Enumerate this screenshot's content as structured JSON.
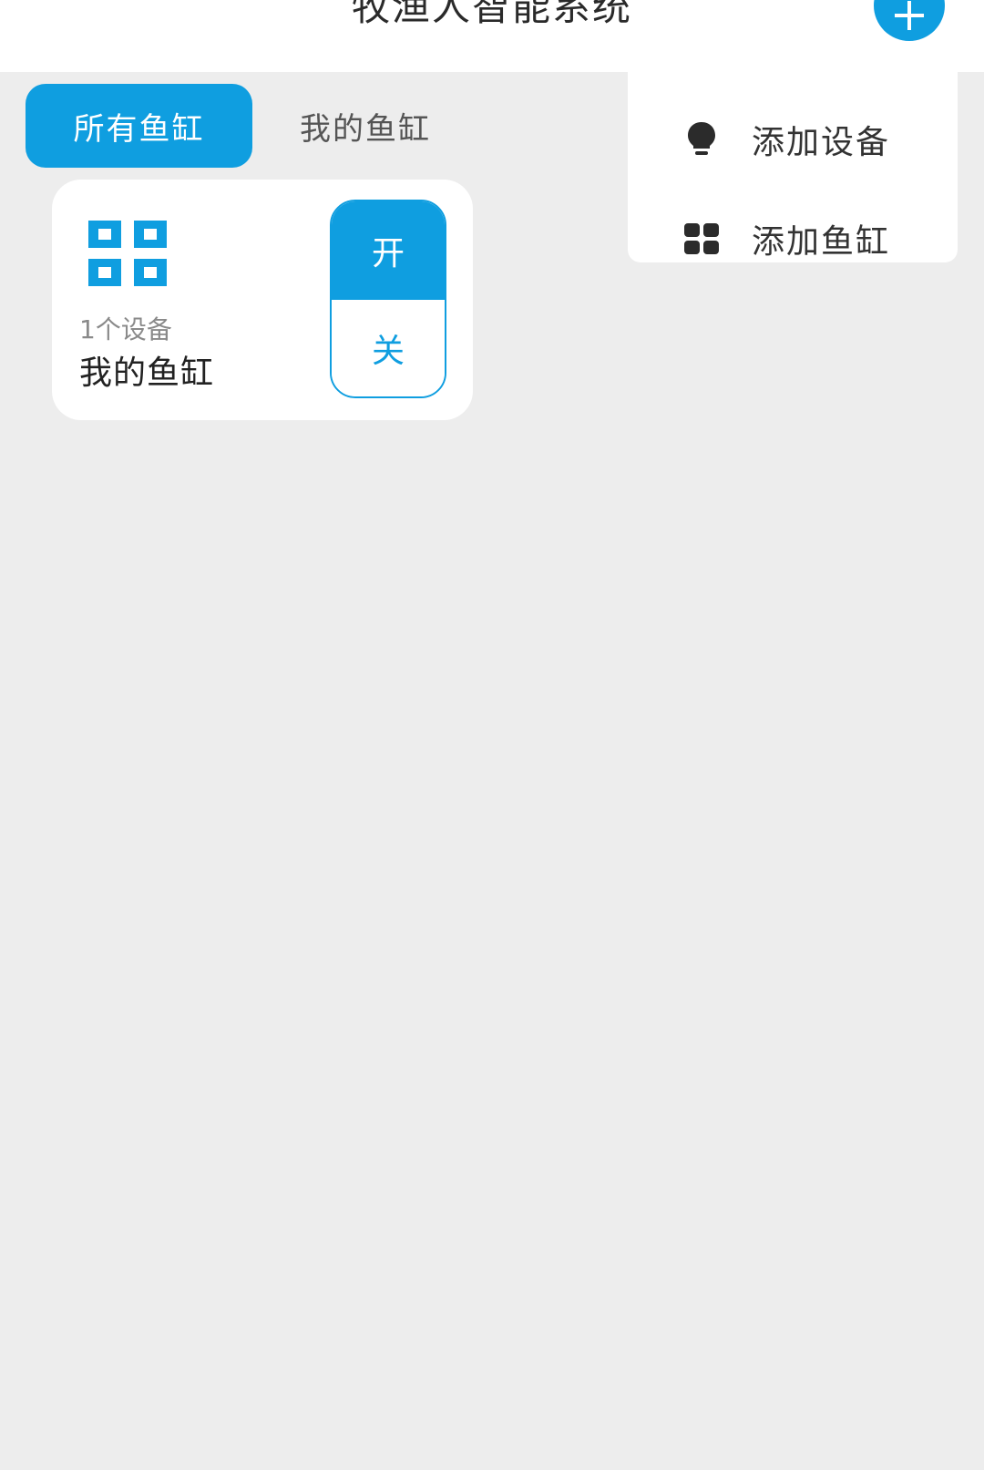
{
  "header": {
    "title": "牧渔人智能系统"
  },
  "tabs": [
    {
      "label": "所有鱼缸",
      "active": true
    },
    {
      "label": "我的鱼缸",
      "active": false
    }
  ],
  "tank_card": {
    "device_count": "1个设备",
    "name": "我的鱼缸",
    "icon": "grid-icon",
    "toggle": {
      "on_label": "开",
      "off_label": "关"
    }
  },
  "dropdown": {
    "items": [
      {
        "label": "添加设备",
        "icon": "lightbulb-icon"
      },
      {
        "label": "添加鱼缸",
        "icon": "grid-icon"
      }
    ]
  },
  "colors": {
    "accent": "#0f9ee0",
    "background": "#ededed",
    "surface": "#ffffff"
  }
}
